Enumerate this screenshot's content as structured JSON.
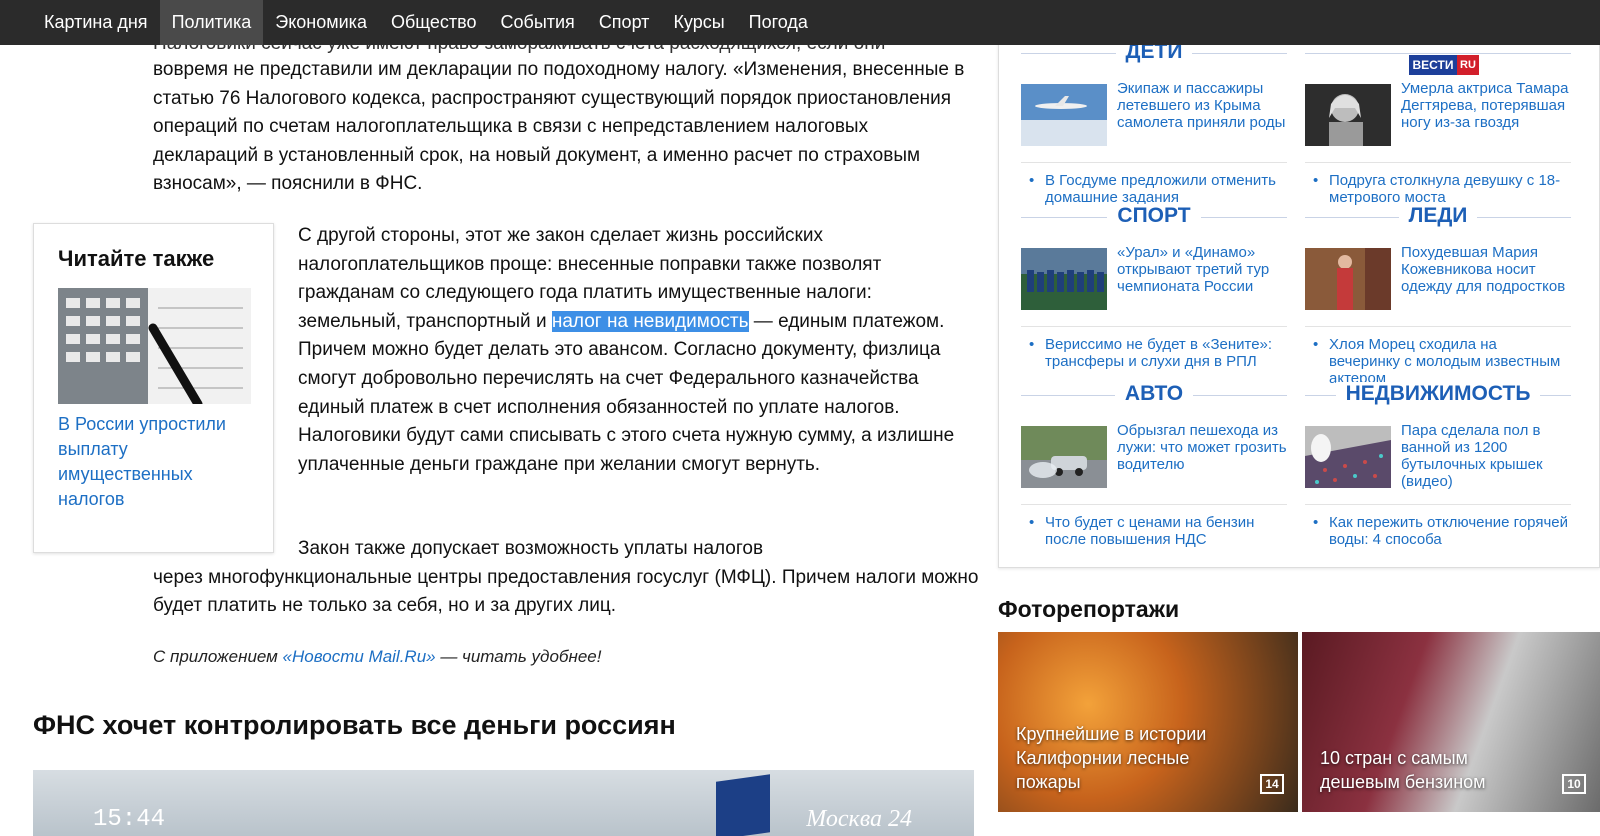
{
  "nav": {
    "items": [
      "Картина дня",
      "Политика",
      "Экономика",
      "Общество",
      "События",
      "Спорт",
      "Курсы",
      "Погода"
    ],
    "active": "Политика"
  },
  "article": {
    "cut_line": "Налоговики сейчас уже имеют право замораживать счета расходящихся, если они",
    "p1": "вовремя не представили им декларации по подоходному налогу. «Изменения, внесенные в статью 76 Налогового кодекса, распространяют существующий порядок приостановления операций по счетам налогоплательщика в связи с непредставлением налоговых деклараций в установленный срок, на новый документ, а именно расчет по страховым взносам», — пояснили в ФНС.",
    "p2_before": "С другой стороны, этот же закон сделает жизнь российских налогоплательщиков проще: внесенные поправки также позволят гражданам со следующего года платить имущественные налоги: земельный, транспортный и ",
    "p2_highlight": "налог на невидимость",
    "p2_after": " — единым платежом. Причем можно будет делать это авансом. Согласно документу, физлица смогут добровольно перечислять на счет Федерального казначейства единый платеж в счет исполнения обязанностей по уплате налогов. Налоговики будут сами списывать с этого счета нужную сумму, а излишне уплаченные деньги граждане при желании смогут вернуть.",
    "p3_line1": "Закон также допускает возможность уплаты налогов",
    "p3_rest": "через многофункциональные центры предоставления госуслуг (МФЦ). Причем налоги можно будет платить не только за себя, но и за других лиц.",
    "app_prefix": "С приложением ",
    "app_link": "«Новости Mail.Ru»",
    "app_suffix": " — читать удобнее!"
  },
  "read_also": {
    "title": "Читайте также",
    "link": "В России упростили выплату имущественных налогов"
  },
  "section": {
    "title": "ФНС хочет контролировать все деньги россиян"
  },
  "video": {
    "clock": "15:44",
    "channel": "Москва 24"
  },
  "news": [
    {
      "category": "ДЕТИ",
      "lead": "Экипаж и пассажиры летевшего из Крыма самолета приняли роды",
      "sub": "В Госдуме предложили отменить домашние задания"
    },
    {
      "category": "",
      "badge_left": "ВЕСТИ",
      "badge_right": "RU",
      "lead": "Умерла актриса Тамара Дегтярева, потерявшая ногу из-за гвоздя",
      "sub": "Подруга столкнула девушку с 18-метрового моста"
    },
    {
      "category": "СПОРТ",
      "lead": "«Урал» и «Динамо» открывают третий тур чемпионата России",
      "sub": "Верисcимо не будет в «Зените»: трансферы и слухи дня в РПЛ"
    },
    {
      "category": "ЛЕДИ",
      "lead": "Похудевшая Мария Кожевникова носит одежду для подростков",
      "sub": "Хлоя Морец сходила на вечеринку с молодым известным актером"
    },
    {
      "category": "АВТО",
      "lead": "Обрызгал пешехода из лужи: что может грозить водителю",
      "sub": "Что будет с ценами на бензин после повышения НДС"
    },
    {
      "category": "НЕДВИЖИМОСТЬ",
      "lead": "Пара сделала пол в ванной из 1200 бутылочных крышек (видео)",
      "sub": "Как пережить отключение горячей воды: 4 способа"
    }
  ],
  "photos": {
    "title": "Фоторепортажи",
    "items": [
      {
        "caption": "Крупнейшие в истории Калифорнии лесные пожары",
        "count": "14"
      },
      {
        "caption": "10 стран с самым дешевым бензином",
        "count": "10"
      }
    ]
  },
  "colors": {
    "nav_bg": "#2b2b2b",
    "link": "#1d6fc4",
    "category": "#1d5fb6",
    "highlight": "#3d8fe6"
  }
}
